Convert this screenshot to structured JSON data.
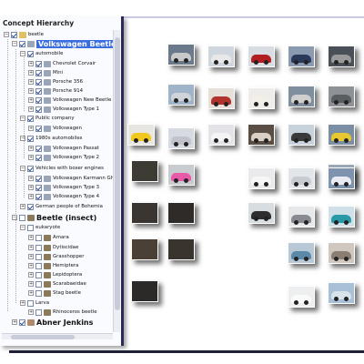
{
  "panel": {
    "title": "Concept Hierarchy",
    "tree": [
      {
        "label": "beetle",
        "icon": "folder",
        "expander": "−",
        "checked": true,
        "style": "normal"
      },
      {
        "label": "Volkswagen Beetle",
        "icon": "car",
        "expander": "−",
        "checked": true,
        "style": "selected-big"
      },
      {
        "label": "automobile",
        "icon": "",
        "expander": "−",
        "checked": true,
        "style": "normal"
      },
      {
        "label": "Chevrolet Corvair",
        "icon": "car",
        "expander": "+",
        "checked": true,
        "style": "normal"
      },
      {
        "label": "Mini",
        "icon": "car",
        "expander": "+",
        "checked": true,
        "style": "normal"
      },
      {
        "label": "Porsche 356",
        "icon": "car",
        "expander": "+",
        "checked": true,
        "style": "normal"
      },
      {
        "label": "Porsche 914",
        "icon": "car",
        "expander": "+",
        "checked": true,
        "style": "normal"
      },
      {
        "label": "Volkswagen New Beetle",
        "icon": "car",
        "expander": "+",
        "checked": true,
        "style": "normal"
      },
      {
        "label": "Volkswagen Type 1",
        "icon": "car",
        "expander": "+",
        "checked": true,
        "style": "normal"
      },
      {
        "label": "Public company",
        "icon": "",
        "expander": "−",
        "checked": true,
        "style": "normal"
      },
      {
        "label": "Volkswagen",
        "icon": "car",
        "expander": "+",
        "checked": true,
        "style": "normal"
      },
      {
        "label": "1980s automobiles",
        "icon": "",
        "expander": "−",
        "checked": true,
        "style": "normal"
      },
      {
        "label": "Volkswagen Passat",
        "icon": "car",
        "expander": "+",
        "checked": true,
        "style": "normal"
      },
      {
        "label": "Volkswagen Type 2",
        "icon": "car",
        "expander": "+",
        "checked": true,
        "style": "normal"
      },
      {
        "label": "Vehicles with boxer engines",
        "icon": "",
        "expander": "−",
        "checked": true,
        "style": "normal"
      },
      {
        "label": "Volkswagen Karmann Gh",
        "icon": "car",
        "expander": "+",
        "checked": true,
        "style": "normal"
      },
      {
        "label": "Volkswagen Type 3",
        "icon": "car",
        "expander": "+",
        "checked": true,
        "style": "normal"
      },
      {
        "label": "Volkswagen Type 4",
        "icon": "car",
        "expander": "+",
        "checked": true,
        "style": "normal"
      },
      {
        "label": "German people of Bohemia",
        "icon": "",
        "expander": "+",
        "checked": true,
        "style": "normal"
      },
      {
        "label": "Beetle (insect)",
        "icon": "bug",
        "expander": "−",
        "checked": false,
        "style": "big"
      },
      {
        "label": "eukaryote",
        "icon": "",
        "expander": "−",
        "checked": false,
        "style": "normal"
      },
      {
        "label": "Amara",
        "icon": "bug",
        "expander": "+",
        "checked": false,
        "style": "normal"
      },
      {
        "label": "Dytiscidae",
        "icon": "bug",
        "expander": "+",
        "checked": false,
        "style": "normal"
      },
      {
        "label": "Grasshopper",
        "icon": "bug",
        "expander": "+",
        "checked": false,
        "style": "normal"
      },
      {
        "label": "Hemiptera",
        "icon": "bug",
        "expander": "+",
        "checked": false,
        "style": "normal"
      },
      {
        "label": "Lepidoptera",
        "icon": "bug",
        "expander": "+",
        "checked": false,
        "style": "normal"
      },
      {
        "label": "Scarabaeidae",
        "icon": "bug",
        "expander": "+",
        "checked": false,
        "style": "normal"
      },
      {
        "label": "Stag beetle",
        "icon": "bug",
        "expander": "+",
        "checked": false,
        "style": "normal"
      },
      {
        "label": "Larva",
        "icon": "",
        "expander": "+",
        "checked": false,
        "style": "normal"
      },
      {
        "label": "Rhinoceros beetle",
        "icon": "bug",
        "expander": "+",
        "checked": false,
        "style": "normal"
      },
      {
        "label": "Abner Jenkins",
        "icon": "person",
        "expander": "+",
        "checked": true,
        "style": "big"
      }
    ]
  },
  "colors": {
    "selection": "#3a6ee0",
    "frame": "#2a2a5a",
    "panel_bg": "#fafbff"
  },
  "thumbnails": [
    {
      "bg": "#6a7a8a",
      "car": "#c9c9c9",
      "kind": "car"
    },
    {
      "bg": "#cfd6de",
      "car": "#e8e8e8",
      "kind": "car"
    },
    {
      "bg": "#d8dde4",
      "car": "#b21e22",
      "kind": "car"
    },
    {
      "bg": "#8a9ab0",
      "car": "#2a3a5a",
      "kind": "car"
    },
    {
      "bg": "#4a5058",
      "car": "#9a9a9a",
      "kind": "car"
    },
    {
      "bg": "#9fb4c8",
      "car": "#d0d4d8",
      "kind": "car"
    },
    {
      "bg": "#e6e0d8",
      "car": "#b0342c",
      "kind": "car"
    },
    {
      "bg": "#f0ecea",
      "car": "#f2eee8",
      "kind": "car"
    },
    {
      "bg": "#7f8fa0",
      "car": "#cfcfcf",
      "kind": "car"
    },
    {
      "bg": "#8e9196",
      "car": "#5a5e62",
      "kind": "car"
    },
    {
      "bg": "#e8e6e0",
      "car": "#f0c81e",
      "kind": "car"
    },
    {
      "bg": "#d6dbe2",
      "car": "#c0c4ca",
      "kind": "car"
    },
    {
      "bg": "#e4e4e8",
      "car": "#f4f4f4",
      "kind": "car"
    },
    {
      "bg": "#5a4e44",
      "car": "#d8d0c4",
      "kind": "car"
    },
    {
      "bg": "#c8d2dc",
      "car": "#3a3a3a",
      "kind": "car"
    },
    {
      "bg": "#7a8ea4",
      "car": "#e8c830",
      "kind": "car"
    },
    {
      "bg": "#9aa8b8",
      "car": "#2c2c30",
      "kind": "car"
    },
    {
      "bg": "#3e3a34",
      "car": "#3e3a34",
      "kind": "dark"
    },
    {
      "bg": "#c8ccd0",
      "car": "#e85aa8",
      "kind": "car"
    },
    {
      "bg": "#eaeaec",
      "car": "#f6f6f6",
      "kind": "car"
    },
    {
      "bg": "#e2e6ea",
      "car": "#c8ccd2",
      "kind": "car"
    },
    {
      "bg": "#7e94ae",
      "car": "#e8ecf2",
      "kind": "car"
    },
    {
      "bg": "#3a3530",
      "car": "#3a3530",
      "kind": "dark"
    },
    {
      "bg": "#2e2b28",
      "car": "#2e2b28",
      "kind": "dark"
    },
    {
      "bg": "#d8dde2",
      "car": "#2e2e30",
      "kind": "car"
    },
    {
      "bg": "#e6e8ea",
      "car": "#888c90",
      "kind": "car"
    },
    {
      "bg": "#cfe0e8",
      "car": "#2a9aa8",
      "kind": "car"
    },
    {
      "bg": "#4a4036",
      "car": "#4a4036",
      "kind": "dark"
    },
    {
      "bg": "#3a342e",
      "car": "#3a342e",
      "kind": "dark"
    },
    {
      "bg": "#b8c8d6",
      "car": "#5a8aa8",
      "kind": "car"
    },
    {
      "bg": "#d0c8be",
      "car": "#8a7e72",
      "kind": "car"
    },
    {
      "bg": "#2c2a28",
      "car": "#2c2a28",
      "kind": "dark"
    },
    {
      "bg": "#eceeef",
      "car": "#fafafa",
      "kind": "car"
    },
    {
      "bg": "#a8c0d8",
      "car": "#d8e2ea",
      "kind": "car"
    }
  ]
}
